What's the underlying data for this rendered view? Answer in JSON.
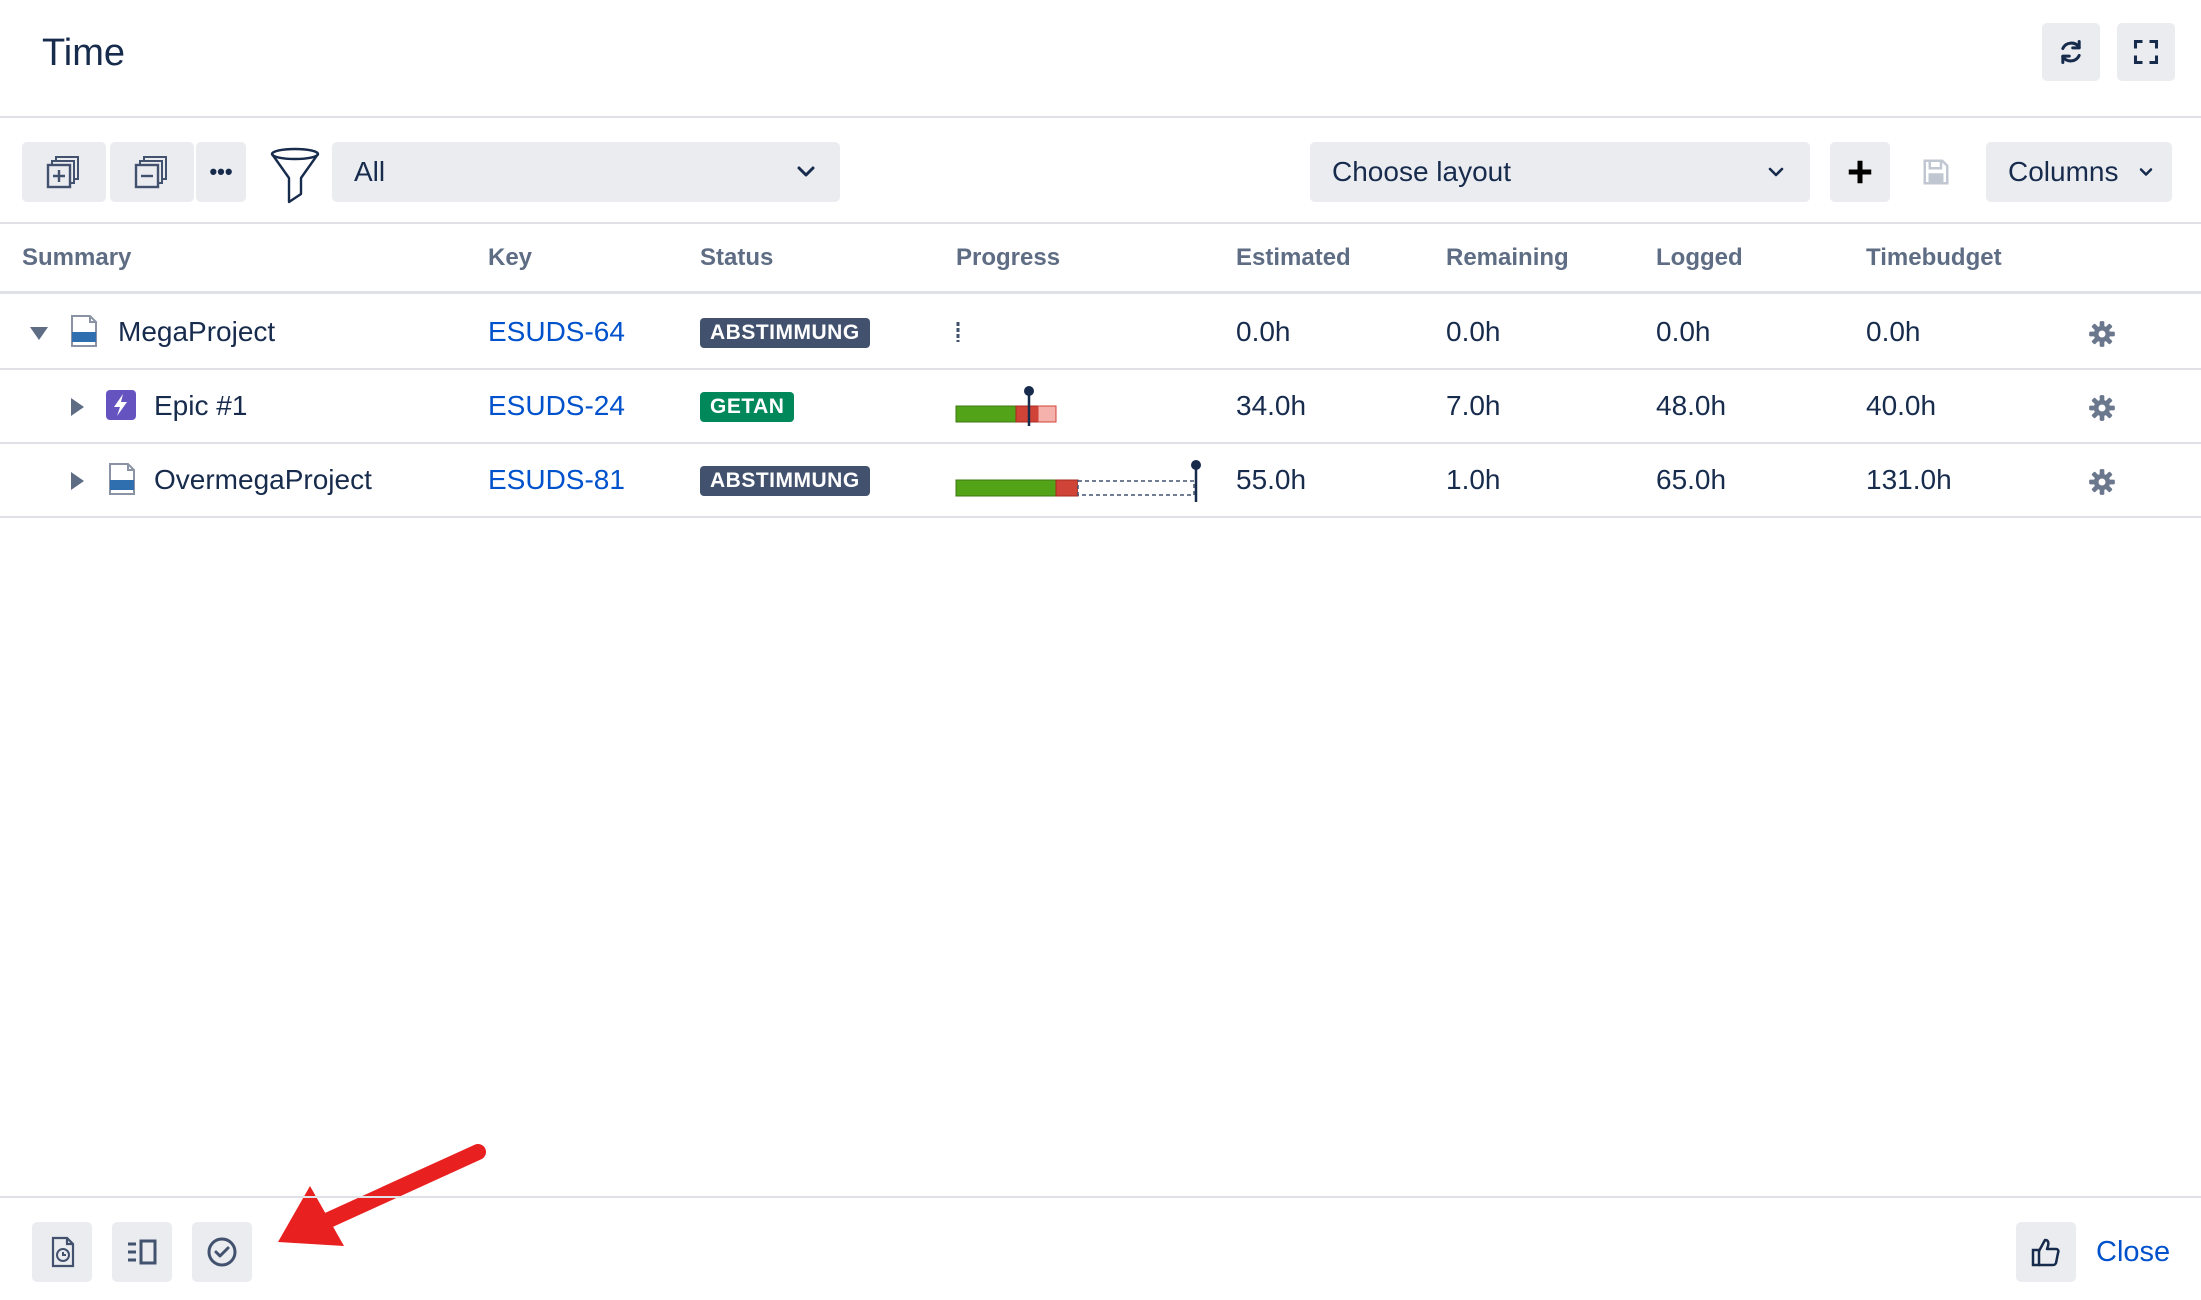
{
  "dialog": {
    "title": "Time"
  },
  "header": {
    "icons": {
      "refresh": "refresh-icon",
      "fullscreen": "fullscreen-icon"
    }
  },
  "toolbar": {
    "expand_icon": "expand-all-icon",
    "collapse_icon": "collapse-all-icon",
    "more_label": "•••",
    "filter_icon": "filter-funnel-icon",
    "filter_value": "All",
    "layout_placeholder": "Choose layout",
    "add_icon": "plus-icon",
    "save_icon": "save-icon",
    "columns_label": "Columns"
  },
  "table": {
    "columns": [
      "Summary",
      "Key",
      "Status",
      "Progress",
      "Estimated",
      "Remaining",
      "Logged",
      "Timebudget"
    ],
    "rows": [
      {
        "summary": "MegaProject",
        "key": "ESUDS-64",
        "status": "ABSTIMMUNG",
        "estimated": "0.0h",
        "remaining": "0.0h",
        "logged": "0.0h",
        "timebudget": "0.0h",
        "expanded": true,
        "issue_type_icon": "page-icon"
      },
      {
        "summary": "Epic #1",
        "key": "ESUDS-24",
        "status": "GETAN",
        "estimated": "34.0h",
        "remaining": "7.0h",
        "logged": "48.0h",
        "timebudget": "40.0h",
        "expanded": false,
        "issue_type_icon": "epic-icon"
      },
      {
        "summary": "OvermegaProject",
        "key": "ESUDS-81",
        "status": "ABSTIMMUNG",
        "estimated": "55.0h",
        "remaining": "1.0h",
        "logged": "65.0h",
        "timebudget": "131.0h",
        "expanded": false,
        "issue_type_icon": "page-icon"
      }
    ]
  },
  "footer": {
    "icons": [
      "timesheet-icon",
      "list-view-icon",
      "check-circle-icon"
    ],
    "like_icon": "thumbs-up-icon",
    "close_label": "Close"
  },
  "colors": {
    "progress_green": "#53a318",
    "progress_red": "#d04437",
    "lozenge_dark": "#42526e",
    "lozenge_green": "#00875a",
    "link": "#0052cc",
    "annotation_arrow": "#e8201f"
  }
}
